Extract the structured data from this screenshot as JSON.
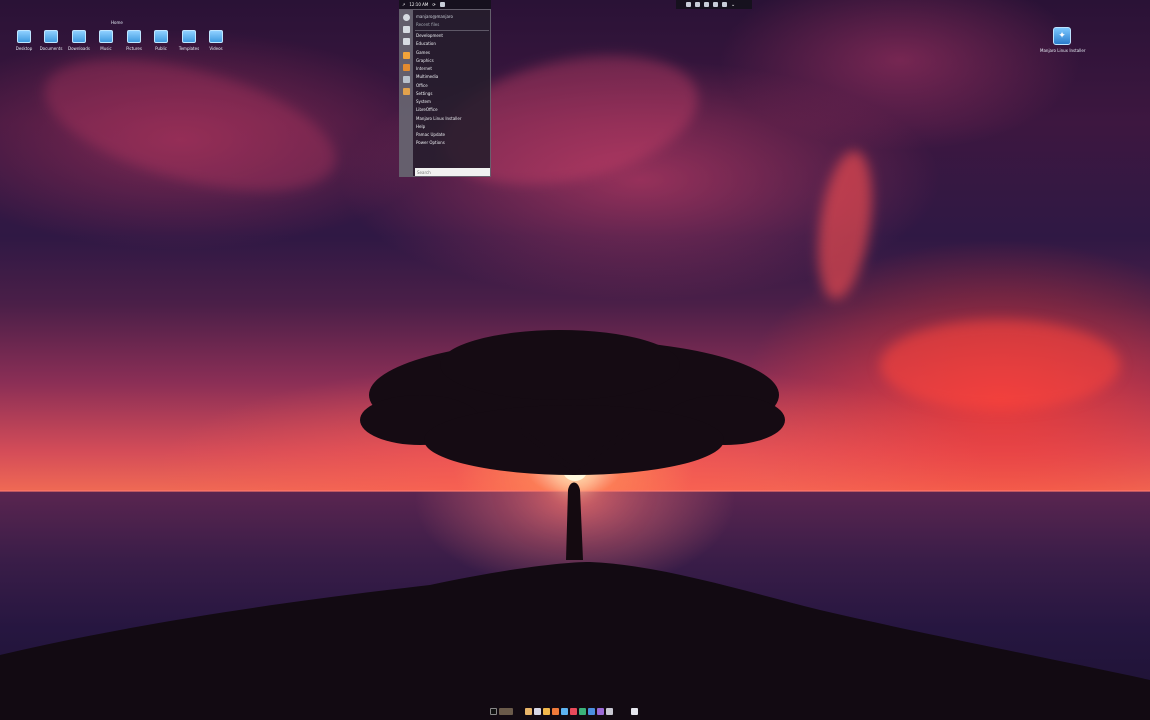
{
  "desktop": {
    "home_label": "Home",
    "icons": [
      {
        "label": "Desktop"
      },
      {
        "label": "Documents"
      },
      {
        "label": "Downloads"
      },
      {
        "label": "Music"
      },
      {
        "label": "Pictures"
      },
      {
        "label": "Public"
      },
      {
        "label": "Templates"
      },
      {
        "label": "Videos"
      }
    ],
    "installer_label": "Manjaro Linux Installer"
  },
  "top_panel": {
    "clock": "12:10 AM",
    "tray_icons": [
      "bluetooth-icon",
      "network-icon",
      "volume-icon",
      "battery-icon",
      "power-icon",
      "chevron-down-icon"
    ]
  },
  "app_menu": {
    "user_name": "manjaro@manjaro",
    "user_sub": "Recent files",
    "categories": [
      "Development",
      "Education",
      "Games",
      "Graphics",
      "Internet",
      "Multimedia",
      "Office",
      "Settings",
      "System",
      "LibreOffice",
      "Manjaro Linux Installer",
      "Help",
      "Pamac Update",
      "Power Options"
    ],
    "search_placeholder": "Search"
  },
  "dock": {
    "colors": [
      "#e9b56a",
      "#d7d7e6",
      "#f2b84b",
      "#f07a3a",
      "#5db3f0",
      "#e94a5a",
      "#3ab27a",
      "#4a8fe0",
      "#9b6ad6",
      "#c8c8d2"
    ]
  }
}
